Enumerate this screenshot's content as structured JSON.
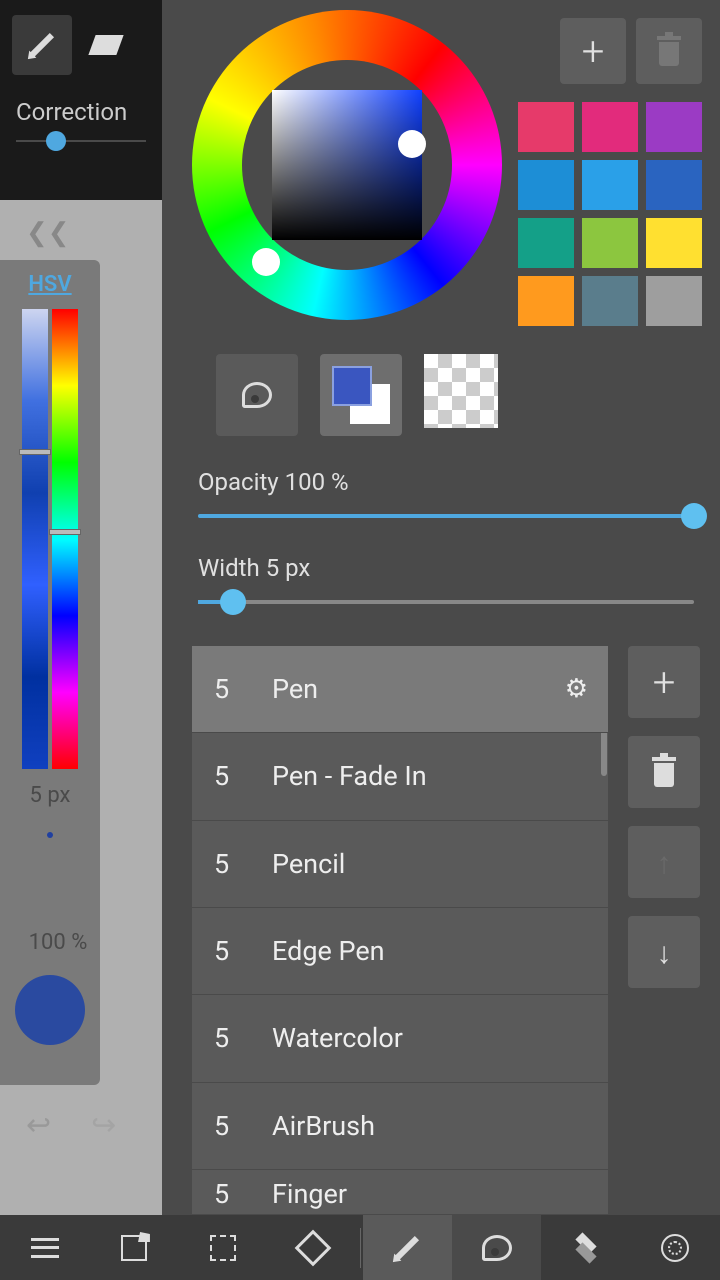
{
  "bg": {
    "correction_label": "Correction",
    "hsv_label": "HSV",
    "size_display": "5 px",
    "opacity_display": "100 %"
  },
  "swatch_actions": {
    "add": "+",
    "delete": "del"
  },
  "swatches": [
    "#e63a6a",
    "#e22b7c",
    "#9b3bc4",
    "#1d8ed6",
    "#2aa0e8",
    "#2a64c0",
    "#14a088",
    "#8cc63f",
    "#ffe030",
    "#ff9a1e",
    "#5a7d8c",
    "#9e9e9e"
  ],
  "opacity": {
    "label": "Opacity 100 %",
    "value": 100
  },
  "width": {
    "label": "Width 5 px",
    "value": 5
  },
  "brushes": [
    {
      "size": "5",
      "name": "Pen",
      "selected": true
    },
    {
      "size": "5",
      "name": "Pen - Fade In"
    },
    {
      "size": "5",
      "name": "Pencil"
    },
    {
      "size": "5",
      "name": "Edge Pen"
    },
    {
      "size": "5",
      "name": "Watercolor"
    },
    {
      "size": "5",
      "name": "AirBrush"
    },
    {
      "size": "5",
      "name": "Finger",
      "partial": true
    }
  ]
}
